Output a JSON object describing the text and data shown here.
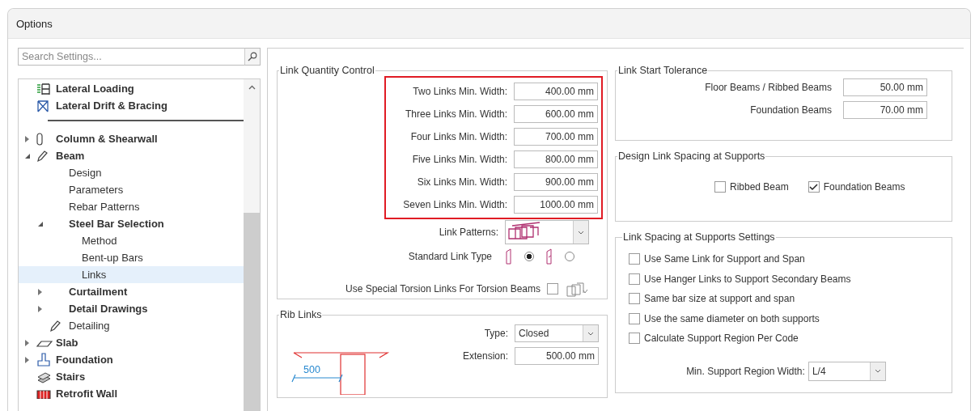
{
  "window": {
    "title": "Options"
  },
  "search": {
    "placeholder": "Search Settings..."
  },
  "tree": [
    {
      "label": "Lateral Loading",
      "kind": "group"
    },
    {
      "label": "Lateral Drift & Bracing",
      "kind": "group"
    },
    {
      "kind": "separator"
    },
    {
      "label": "Column & Shearwall",
      "kind": "group",
      "expanded": false
    },
    {
      "label": "Beam",
      "kind": "group",
      "expanded": true,
      "children": [
        {
          "label": "Design",
          "kind": "page",
          "selected": false
        },
        {
          "label": "Parameters",
          "kind": "page",
          "selected": false
        },
        {
          "label": "Rebar Patterns",
          "kind": "page",
          "selected": false
        },
        {
          "label": "Steel Bar Selection",
          "kind": "group",
          "expanded": true,
          "children": [
            {
              "label": "Method",
              "kind": "page",
              "selected": false
            },
            {
              "label": "Bent-up Bars",
              "kind": "page",
              "selected": false
            },
            {
              "label": "Links",
              "kind": "page",
              "selected": true
            }
          ]
        },
        {
          "label": "Curtailment",
          "kind": "group",
          "expanded": false
        },
        {
          "label": "Detail Drawings",
          "kind": "group",
          "expanded": false
        },
        {
          "label": "Detailing",
          "kind": "page",
          "selected": false
        }
      ]
    },
    {
      "label": "Slab",
      "kind": "group",
      "expanded": false
    },
    {
      "label": "Foundation",
      "kind": "group",
      "expanded": false
    },
    {
      "label": "Stairs",
      "kind": "group"
    },
    {
      "label": "Retrofit Wall",
      "kind": "group"
    }
  ],
  "link_quantity_control": {
    "title": "Link Quantity Control",
    "widths": [
      {
        "label": "Two Links Min. Width:",
        "value": "400.00 mm"
      },
      {
        "label": "Three Links Min. Width:",
        "value": "600.00 mm"
      },
      {
        "label": "Four Links Min. Width:",
        "value": "700.00 mm"
      },
      {
        "label": "Five Links Min. Width:",
        "value": "800.00 mm"
      },
      {
        "label": "Six Links Min. Width:",
        "value": "900.00 mm"
      },
      {
        "label": "Seven Links Min. Width:",
        "value": "1000.00 mm"
      }
    ],
    "link_patterns_label": "Link Patterns:",
    "standard_link_type_label": "Standard Link Type",
    "standard_link_types": [
      {
        "selected": true
      },
      {
        "selected": false
      }
    ],
    "torsion": {
      "label": "Use Special Torsion Links For Torsion Beams",
      "checked": false
    }
  },
  "rib_links": {
    "title": "Rib Links",
    "dimension_label": "500",
    "type_label": "Type:",
    "type_value": "Closed",
    "extension_label": "Extension:",
    "extension_value": "500.00 mm"
  },
  "link_start_tolerance": {
    "title": "Link Start Tolerance",
    "fields": [
      {
        "label": "Floor Beams / Ribbed Beams",
        "value": "50.00 mm"
      },
      {
        "label": "Foundation Beams",
        "value": "70.00 mm"
      }
    ]
  },
  "design_link_spacing": {
    "title": "Design Link Spacing at Supports",
    "options": [
      {
        "label": "Ribbed Beam",
        "checked": false
      },
      {
        "label": "Foundation Beams",
        "checked": true
      }
    ]
  },
  "link_spacing_settings": {
    "title": "Link Spacing at Supports Settings",
    "options": [
      {
        "label": "Use Same Link for Support and Span",
        "checked": false
      },
      {
        "label": "Use Hanger Links to Support Secondary Beams",
        "checked": false
      },
      {
        "label": "Same bar size at support and span",
        "checked": false
      },
      {
        "label": "Use the same diameter on both supports",
        "checked": false
      },
      {
        "label": "Calculate Support Region Per Code",
        "checked": false
      }
    ],
    "min_width_label": "Min. Support Region Width:",
    "min_width_value": "L/4"
  }
}
